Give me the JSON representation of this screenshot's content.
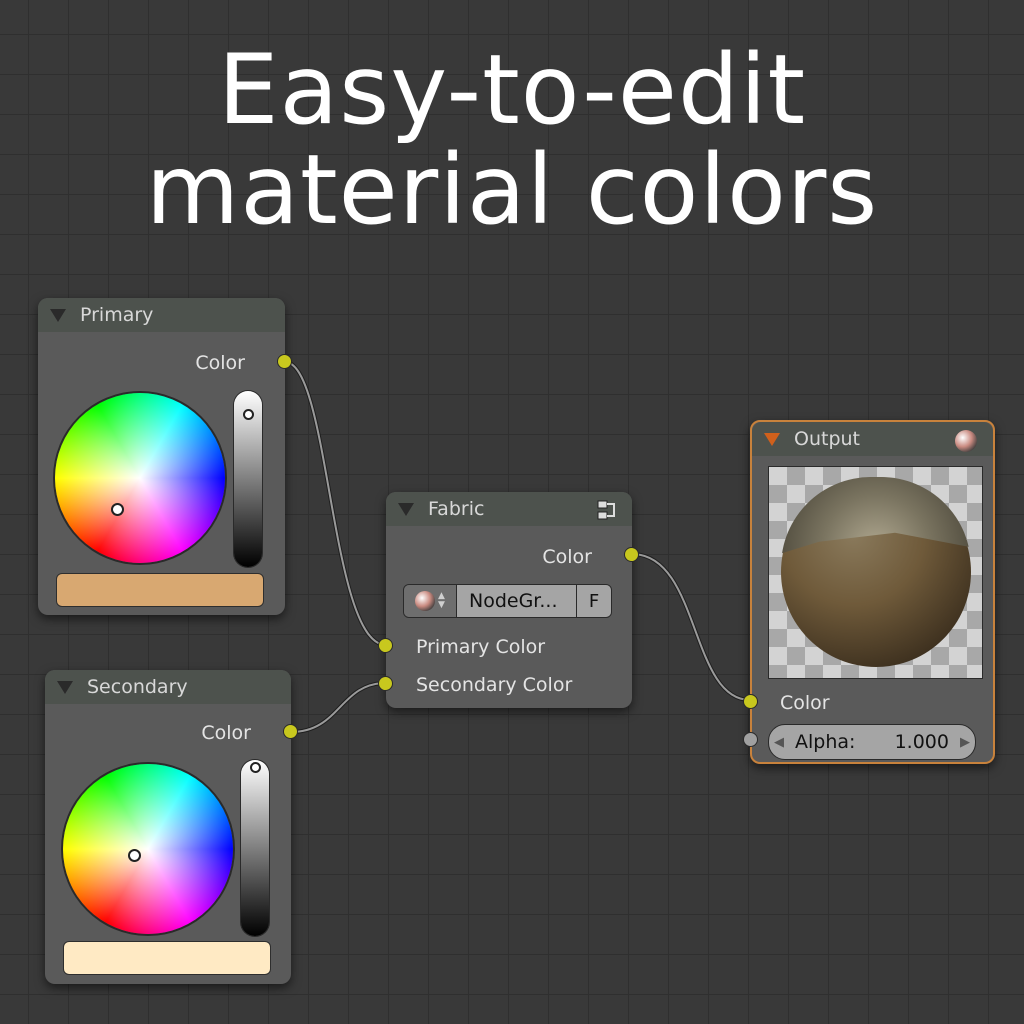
{
  "headline": {
    "line1": "Easy-to-edit",
    "line2": "material colors"
  },
  "nodes": {
    "primary": {
      "title": "Primary",
      "output_label": "Color",
      "swatch_color": "#d8a871",
      "value_level": 0.9
    },
    "secondary": {
      "title": "Secondary",
      "output_label": "Color",
      "swatch_color": "#ffeac4",
      "value_level": 1.0
    },
    "fabric": {
      "title": "Fabric",
      "output_label": "Color",
      "group_name": "NodeGr...",
      "fake_user": "F",
      "inputs": [
        "Primary Color",
        "Secondary Color"
      ]
    },
    "output": {
      "title": "Output",
      "input_label": "Color",
      "alpha_label": "Alpha:",
      "alpha_value": "1.000"
    }
  },
  "colors": {
    "socket_color": "#c8c81e",
    "output_border": "#c8823c",
    "output_arrow": "#d0601c"
  }
}
